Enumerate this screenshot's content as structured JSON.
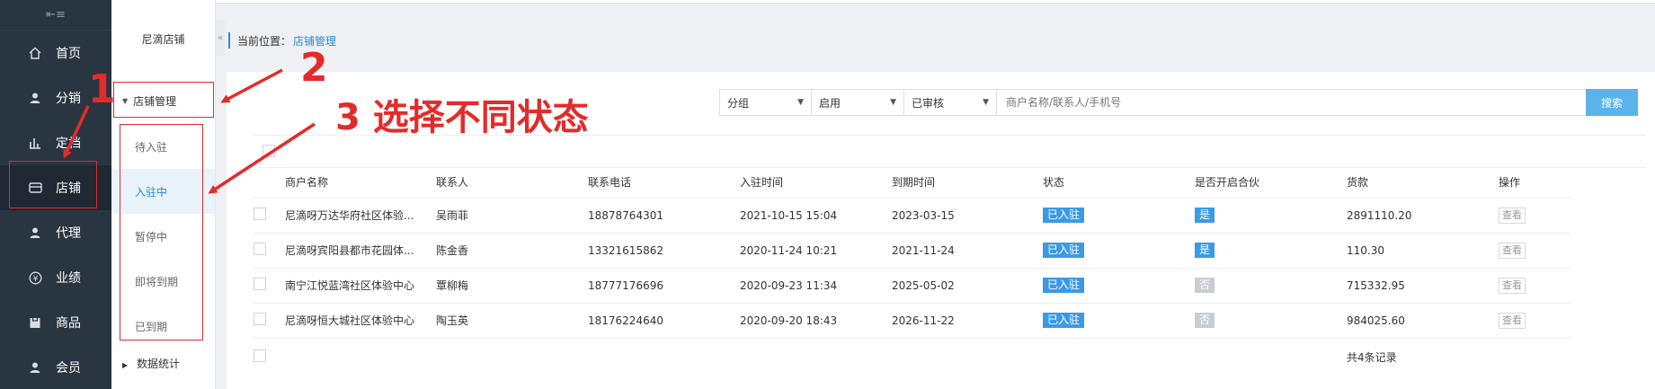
{
  "sidebar": {
    "collapse_icon": "collapse-icon",
    "items": [
      {
        "label": "首页",
        "icon": "home-icon"
      },
      {
        "label": "分销",
        "icon": "user-icon"
      },
      {
        "label": "定档",
        "icon": "chart-icon"
      },
      {
        "label": "店铺",
        "icon": "store-icon"
      },
      {
        "label": "代理",
        "icon": "user-icon"
      },
      {
        "label": "业绩",
        "icon": "yen-icon"
      },
      {
        "label": "商品",
        "icon": "goods-icon"
      },
      {
        "label": "会员",
        "icon": "user-icon"
      }
    ]
  },
  "subnav": {
    "title": "尼滴店铺",
    "group": "店铺管理",
    "items": [
      "待入驻",
      "入驻中",
      "暂停中",
      "即将到期",
      "已到期"
    ],
    "stats": "数据统计"
  },
  "breadcrumb": {
    "prefix": "当前位置：",
    "current": "店铺管理"
  },
  "filters": {
    "group": "分组",
    "enabled": "启用",
    "audit": "已审核",
    "search_placeholder": "商户名称/联系人/手机号",
    "search_button": "搜索"
  },
  "table": {
    "headers": [
      "商户名称",
      "联系人",
      "联系电话",
      "入驻时间",
      "到期时间",
      "状态",
      "是否开启合伙",
      "货款",
      "操作"
    ],
    "rows": [
      {
        "name": "尼滴呀万达华府社区体验...",
        "contact": "吴雨菲",
        "phone": "18878764301",
        "join": "2021-10-15 15:04",
        "expire": "2023-03-15",
        "status": "已入驻",
        "partner": "是",
        "payment": "2891110.20",
        "action": "查看"
      },
      {
        "name": "尼滴呀宾阳县都市花园体...",
        "contact": "陈金香",
        "phone": "13321615862",
        "join": "2020-11-24 10:21",
        "expire": "2021-11-24",
        "status": "已入驻",
        "partner": "是",
        "payment": "110.30",
        "action": "查看"
      },
      {
        "name": "南宁江悦蓝湾社区体验中心",
        "contact": "覃柳梅",
        "phone": "18777176696",
        "join": "2020-09-23 11:34",
        "expire": "2025-05-02",
        "status": "已入驻",
        "partner": "否",
        "payment": "715332.95",
        "action": "查看"
      },
      {
        "name": "尼滴呀恒大城社区体验中心",
        "contact": "陶玉英",
        "phone": "18176224640",
        "join": "2020-09-20 18:43",
        "expire": "2026-11-22",
        "status": "已入驻",
        "partner": "否",
        "payment": "984025.60",
        "action": "查看"
      }
    ],
    "total": "共4条记录"
  },
  "annotations": {
    "step1": "1",
    "step2": "2",
    "step3": "3 选择不同状态"
  },
  "colors": {
    "sidebar_bg": "#2a3542",
    "accent": "#2b8ad6",
    "badge_blue": "#3a9ae6",
    "badge_gray": "#c9cdd2",
    "annotation_red": "#e32b2b"
  }
}
